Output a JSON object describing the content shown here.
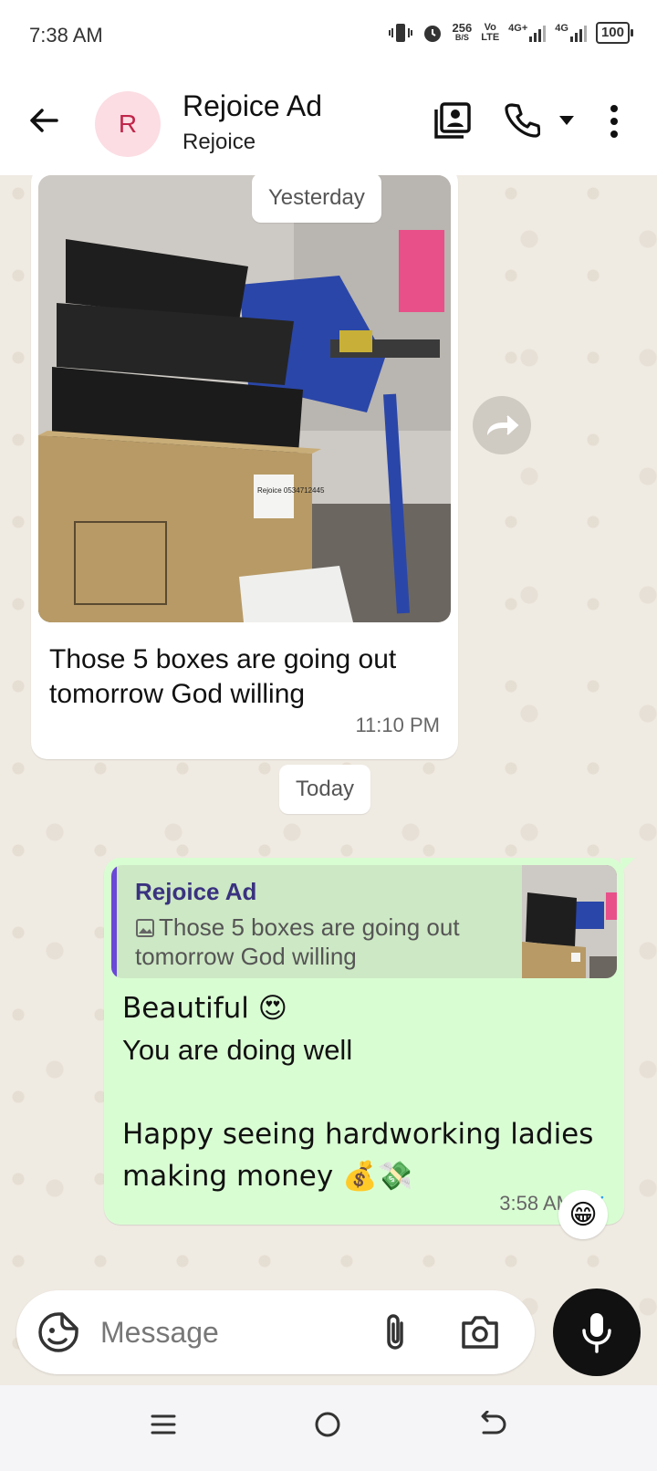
{
  "status_bar": {
    "time": "7:38 AM",
    "net_speed_value": "256",
    "net_speed_unit": "B/S",
    "volte_top": "Vo",
    "volte_bottom": "LTE",
    "net1": "4G+",
    "net2": "4G",
    "battery": "100"
  },
  "header": {
    "avatar_initial": "R",
    "contact_name": "Rejoice Ad",
    "subtitle": "Rejoice",
    "icons": [
      "back-arrow-icon",
      "contacts-icon",
      "phone-icon",
      "dropdown-icon",
      "more-vert-icon"
    ]
  },
  "chat": {
    "date_yesterday": "Yesterday",
    "date_today": "Today",
    "incoming": {
      "caption": "Those 5 boxes are going out tomorrow God willing",
      "time": "11:10 PM",
      "photo_box_label": "Rejoice 0534712445"
    },
    "outgoing": {
      "quote_author": "Rejoice Ad",
      "quote_text": "Those 5 boxes are going out tomorrow God willing",
      "text_line1": "Beautiful 😍",
      "text_line2": "You are doing well",
      "text_line3": "Happy seeing hardworking ladies making money 💰💸",
      "time": "3:58 AM",
      "status": "read"
    },
    "reaction": "😁"
  },
  "composer": {
    "placeholder": "Message"
  },
  "colors": {
    "outgoing_bubble": "#d9fdd3",
    "quote_bar": "#6a48d8",
    "read_tick": "#2a9df4",
    "avatar_bg": "#fbdde3",
    "avatar_fg": "#c0264a"
  }
}
